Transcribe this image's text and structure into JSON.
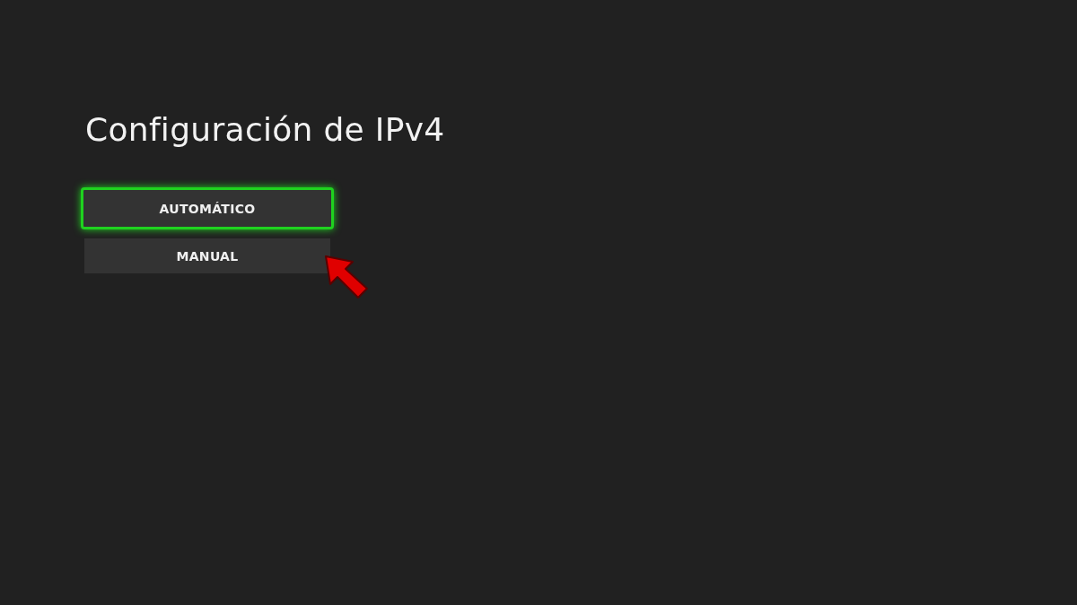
{
  "title": "Configuración de IPv4",
  "options": [
    {
      "label": "AUTOMÁTICO",
      "selected": true,
      "pointed_at": false
    },
    {
      "label": "MANUAL",
      "selected": false,
      "pointed_at": true
    }
  ]
}
